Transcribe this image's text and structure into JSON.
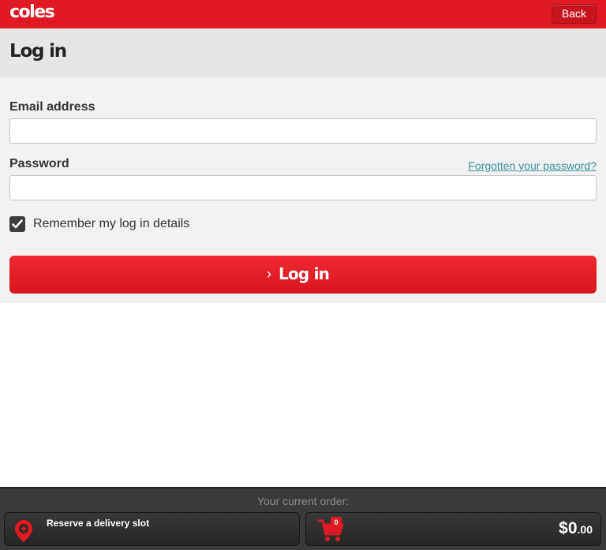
{
  "header": {
    "logo_text": "coles",
    "back_label": "Back",
    "brand_color": "#e01a22"
  },
  "page": {
    "title": "Log in"
  },
  "form": {
    "email_label": "Email address",
    "email_value": "",
    "password_label": "Password",
    "password_value": "",
    "forgot_link": "Forgotten your password?",
    "remember_label": "Remember my log in details",
    "remember_checked": true,
    "submit_label": "Log in",
    "submit_icon": "chevron-right-icon"
  },
  "order_bar": {
    "heading": "Your current order:",
    "delivery_label": "Reserve a delivery slot",
    "delivery_icon": "location-pin-icon",
    "cart_icon": "shopping-cart-icon",
    "cart_count": "0",
    "total_dollars": "$0",
    "total_cents": ".00"
  }
}
